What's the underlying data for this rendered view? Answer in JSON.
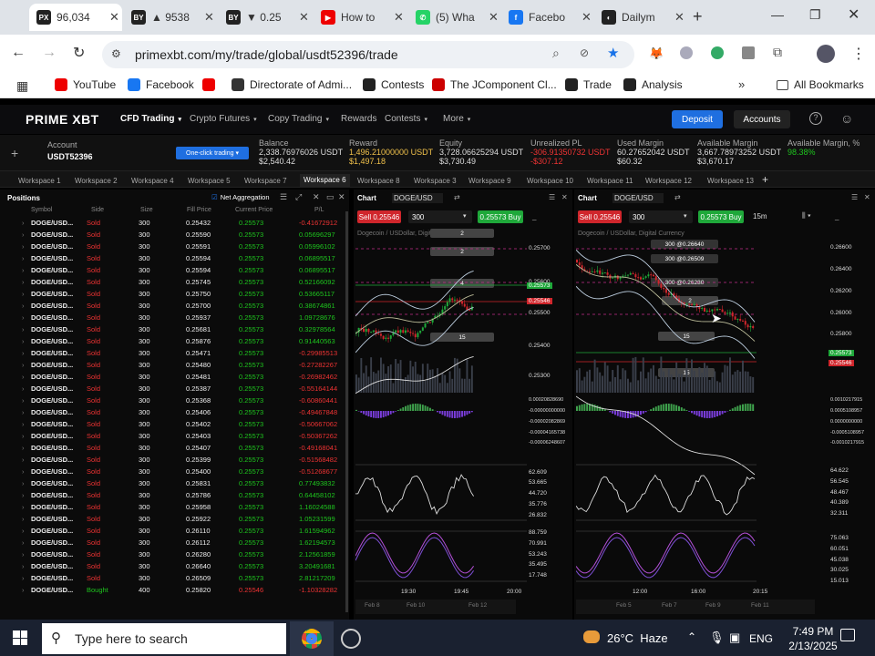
{
  "browser": {
    "tabs": [
      {
        "title": "96,034",
        "color": "#222",
        "glyph": "PX"
      },
      {
        "title": "▲ 9538",
        "color": "#222",
        "glyph": "BY"
      },
      {
        "title": "▼ 0.25",
        "color": "#222",
        "glyph": "BY"
      },
      {
        "title": "How to",
        "color": "#e00",
        "glyph": "▶"
      },
      {
        "title": "(5) Wha",
        "color": "#25d366",
        "glyph": "✆"
      },
      {
        "title": "Facebo",
        "color": "#1877f2",
        "glyph": "f"
      },
      {
        "title": "Dailym",
        "color": "#222",
        "glyph": "◐"
      }
    ],
    "url": "primexbt.com/my/trade/global/usdt52396/trade",
    "bookmarks": [
      "YouTube",
      "Facebook",
      "",
      "Directorate of Admi...",
      "Contests",
      "The JComponent Cl...",
      "Trade",
      "Analysis"
    ],
    "all_bookmarks": "All Bookmarks"
  },
  "app": {
    "logo": "PRIME XBT",
    "nav": [
      "CFD Trading",
      "Crypto Futures",
      "Copy Trading",
      "Rewards",
      "Contests",
      "More"
    ],
    "deposit": "Deposit",
    "accounts": "Accounts",
    "account_label": "Account",
    "account_id": "USDT52396",
    "one_click": "One-click trading",
    "stats": [
      {
        "k": "Balance",
        "v": "2,338.76976026 USDT",
        "s": "$2,540.42",
        "c": "#ddd"
      },
      {
        "k": "Reward",
        "v": "1,496.21000000 USDT",
        "s": "$1,497.18",
        "c": "#f0c14b"
      },
      {
        "k": "Equity",
        "v": "3,728.06625294 USDT",
        "s": "$3,730.49",
        "c": "#ddd"
      },
      {
        "k": "Unrealized PL",
        "v": "-306.91350732 USDT",
        "s": "-$307.12",
        "c": "#e33"
      },
      {
        "k": "Used Margin",
        "v": "60.27652042 USDT",
        "s": "$60.32",
        "c": "#ddd"
      },
      {
        "k": "Available Margin",
        "v": "3,667.78973252 USDT",
        "s": "$3,670.17",
        "c": "#ddd"
      },
      {
        "k": "Available Margin, %",
        "v": "98.38%",
        "s": "",
        "c": "#1ec51e"
      }
    ],
    "workspaces": [
      "Workspace 1",
      "Workspace 2",
      "Workspace 4",
      "Workspace 5",
      "Workspace 7",
      "Workspace 6",
      "Workspace 8",
      "Workspace 3",
      "Workspace 9",
      "Workspace 10",
      "Workspace 11",
      "Workspace 12",
      "Workspace 13"
    ]
  },
  "positions": {
    "title": "Positions",
    "net_agg": "Net Aggregation",
    "headers": [
      "Symbol",
      "Side",
      "Size",
      "Fill Price",
      "Current Price",
      "P/L"
    ],
    "rows": [
      [
        "DOGE/USD...",
        "Sold",
        "300",
        "0.25432",
        "0.25573",
        "-0.41672912"
      ],
      [
        "DOGE/USD...",
        "Sold",
        "300",
        "0.25590",
        "0.25573",
        "0.05696297"
      ],
      [
        "DOGE/USD...",
        "Sold",
        "300",
        "0.25591",
        "0.25573",
        "0.05996102"
      ],
      [
        "DOGE/USD...",
        "Sold",
        "300",
        "0.25594",
        "0.25573",
        "0.06895517"
      ],
      [
        "DOGE/USD...",
        "Sold",
        "300",
        "0.25594",
        "0.25573",
        "0.06895517"
      ],
      [
        "DOGE/USD...",
        "Sold",
        "300",
        "0.25745",
        "0.25573",
        "0.52166092"
      ],
      [
        "DOGE/USD...",
        "Sold",
        "300",
        "0.25750",
        "0.25573",
        "0.53665117"
      ],
      [
        "DOGE/USD...",
        "Sold",
        "300",
        "0.25700",
        "0.25573",
        "0.38674861"
      ],
      [
        "DOGE/USD...",
        "Sold",
        "300",
        "0.25937",
        "0.25573",
        "1.09728676"
      ],
      [
        "DOGE/USD...",
        "Sold",
        "300",
        "0.25681",
        "0.25573",
        "0.32978564"
      ],
      [
        "DOGE/USD...",
        "Sold",
        "300",
        "0.25876",
        "0.25573",
        "0.91440563"
      ],
      [
        "DOGE/USD...",
        "Sold",
        "300",
        "0.25471",
        "0.25573",
        "-0.29985513"
      ],
      [
        "DOGE/USD...",
        "Sold",
        "300",
        "0.25480",
        "0.25573",
        "-0.27282267"
      ],
      [
        "DOGE/USD...",
        "Sold",
        "300",
        "0.25481",
        "0.25573",
        "-0.26982462"
      ],
      [
        "DOGE/USD...",
        "Sold",
        "300",
        "0.25387",
        "0.25573",
        "-0.55164144"
      ],
      [
        "DOGE/USD...",
        "Sold",
        "300",
        "0.25368",
        "0.25573",
        "-0.60860441"
      ],
      [
        "DOGE/USD...",
        "Sold",
        "300",
        "0.25406",
        "0.25573",
        "-0.49467848"
      ],
      [
        "DOGE/USD...",
        "Sold",
        "300",
        "0.25402",
        "0.25573",
        "-0.50667062"
      ],
      [
        "DOGE/USD...",
        "Sold",
        "300",
        "0.25403",
        "0.25573",
        "-0.50367262"
      ],
      [
        "DOGE/USD...",
        "Sold",
        "300",
        "0.25407",
        "0.25573",
        "-0.49168041"
      ],
      [
        "DOGE/USD...",
        "Sold",
        "300",
        "0.25399",
        "0.25573",
        "-0.51568482"
      ],
      [
        "DOGE/USD...",
        "Sold",
        "300",
        "0.25400",
        "0.25573",
        "-0.51268677"
      ],
      [
        "DOGE/USD...",
        "Sold",
        "300",
        "0.25831",
        "0.25573",
        "0.77493832"
      ],
      [
        "DOGE/USD...",
        "Sold",
        "300",
        "0.25786",
        "0.25573",
        "0.64458102"
      ],
      [
        "DOGE/USD...",
        "Sold",
        "300",
        "0.25958",
        "0.25573",
        "1.16024588"
      ],
      [
        "DOGE/USD...",
        "Sold",
        "300",
        "0.25922",
        "0.25573",
        "1.05231599"
      ],
      [
        "DOGE/USD...",
        "Sold",
        "300",
        "0.26110",
        "0.25573",
        "1.61594962"
      ],
      [
        "DOGE/USD...",
        "Sold",
        "300",
        "0.26112",
        "0.25573",
        "1.62194573"
      ],
      [
        "DOGE/USD...",
        "Sold",
        "300",
        "0.26280",
        "0.25573",
        "2.12561859"
      ],
      [
        "DOGE/USD...",
        "Sold",
        "300",
        "0.26640",
        "0.25573",
        "3.20491681"
      ],
      [
        "DOGE/USD...",
        "Sold",
        "300",
        "0.26509",
        "0.25573",
        "2.81217209"
      ],
      [
        "DOGE/USD...",
        "Bought",
        "400",
        "0.25820",
        "0.25546",
        "-1.10328282"
      ]
    ]
  },
  "chart1": {
    "label": "Chart",
    "symbol": "DOGE/USD",
    "sell": "Sell 0.25546",
    "qty": "300",
    "buy": "0.25573 Buy",
    "legend": "Dogecoin / USDollar, Digital",
    "price_ticks": [
      "0.25700",
      "0.25600",
      "0.25500",
      "0.25400",
      "0.25300"
    ],
    "tag_buy": "0.25573",
    "tag_sell": "0.25546",
    "macd_ticks": [
      "0.00020828690",
      "-0.00000000000",
      "-0.00002082869",
      "-0.00004165738",
      "-0.00006248607"
    ],
    "rsi_ticks": [
      "62.609",
      "53.665",
      "44.720",
      "35.776",
      "26.832"
    ],
    "stoch_ticks": [
      "88.759",
      "70.991",
      "53.243",
      "35.495",
      "17.748"
    ],
    "time_ticks": [
      "19:30",
      "19:45",
      "20:00"
    ],
    "bottom": [
      "Feb 8",
      "Feb 10",
      "Feb 12"
    ],
    "boxes": [
      "2",
      "2",
      "4",
      "15"
    ]
  },
  "chart2": {
    "label": "Chart",
    "symbol": "DOGE/USD",
    "sell": "Sell 0.25546",
    "qty": "300",
    "buy": "0.25573 Buy",
    "tf": "15m",
    "legend": "Dogecoin / USDollar, Digital Currency",
    "price_ticks": [
      "0.26600",
      "0.26400",
      "0.26200",
      "0.26000",
      "0.25800",
      "0.25400"
    ],
    "tag_buy": "0.25573",
    "tag_sell": "0.25546",
    "macd_ticks": [
      "0.0010217915",
      "0.0005108957",
      "0.0000000000",
      "-0.0005108957",
      "-0.0010217915"
    ],
    "rsi_ticks": [
      "64.622",
      "56.545",
      "48.467",
      "40.389",
      "32.311"
    ],
    "stoch_ticks": [
      "75.063",
      "60.051",
      "45.038",
      "30.025",
      "15.013"
    ],
    "time_ticks": [
      "12:00",
      "16:00",
      "20:15"
    ],
    "bottom": [
      "Feb 5",
      "Feb 7",
      "Feb 9",
      "Feb 11"
    ],
    "order_lines": [
      "300 @0.26640",
      "300 @0.26509",
      "300 @0.26280"
    ],
    "boxes": [
      "2",
      "15",
      "15"
    ]
  },
  "taskbar": {
    "search": "Type here to search",
    "weather": "26°C  Haze",
    "lang": "ENG",
    "time": "7:49 PM",
    "date": "2/13/2025"
  }
}
